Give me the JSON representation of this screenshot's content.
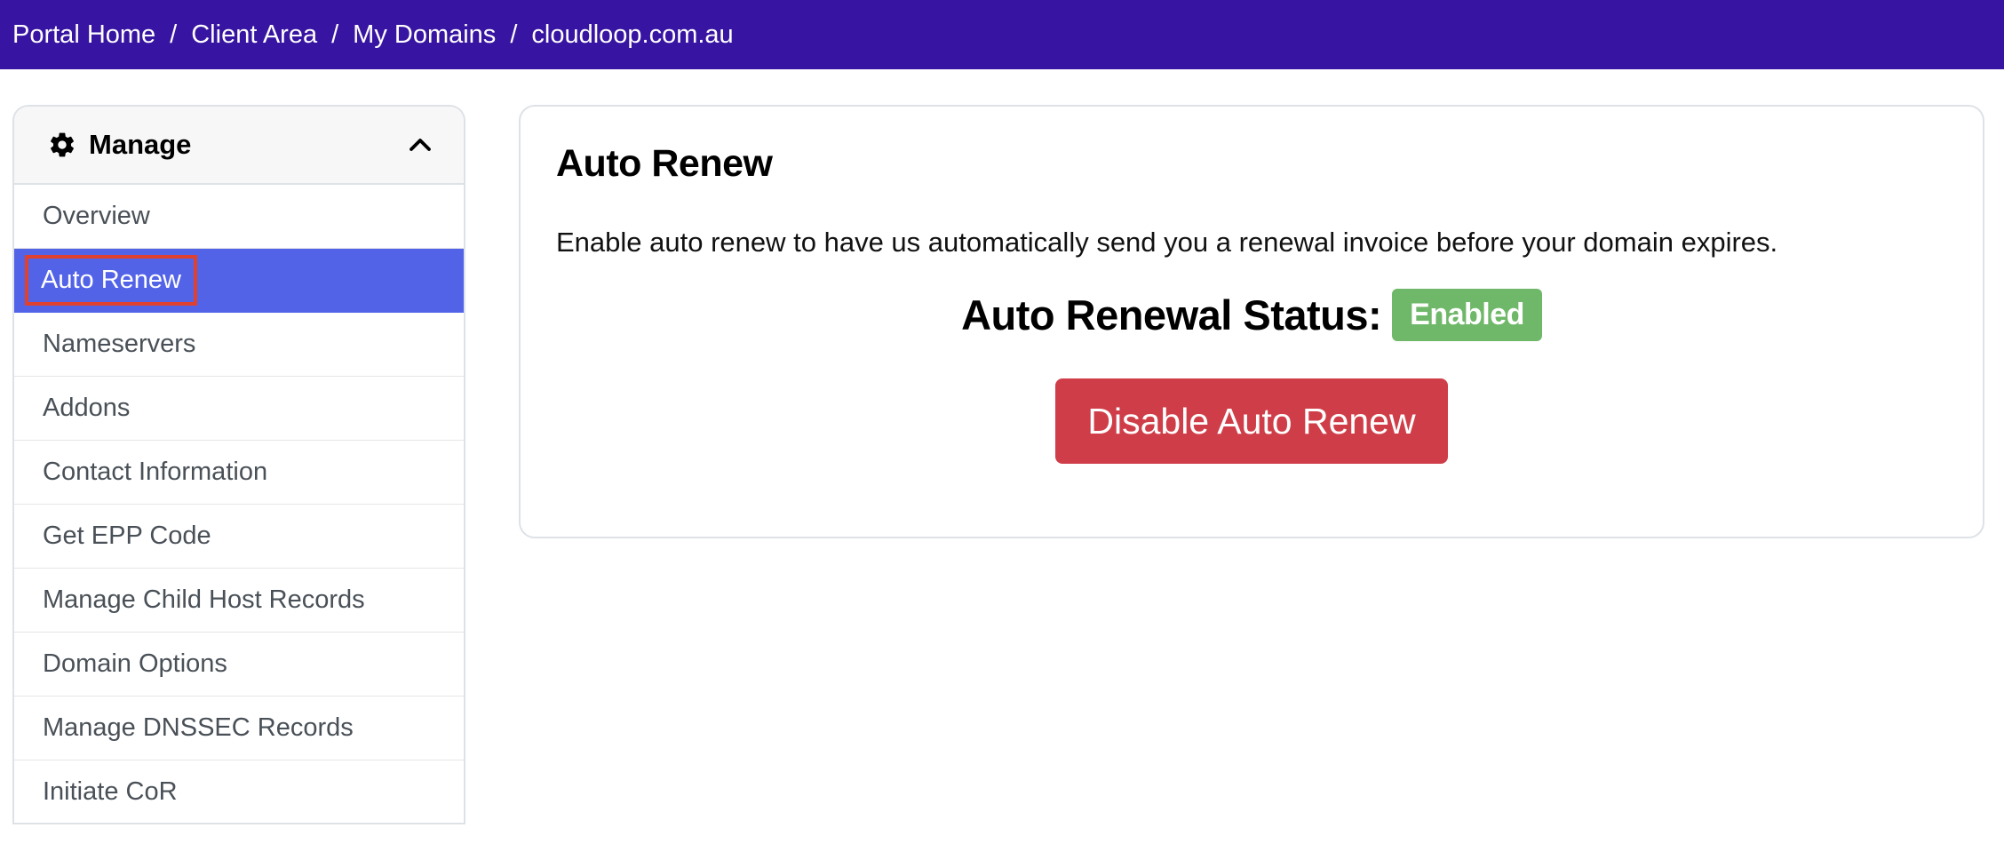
{
  "breadcrumb": {
    "items": [
      "Portal Home",
      "Client Area",
      "My Domains",
      "cloudloop.com.au"
    ],
    "separator": "/"
  },
  "sidebar": {
    "header": {
      "title": "Manage",
      "icon": "gear-icon",
      "toggle_icon": "chevron-up-icon"
    },
    "items": [
      {
        "label": "Overview",
        "active": false
      },
      {
        "label": "Auto Renew",
        "active": true
      },
      {
        "label": "Nameservers",
        "active": false
      },
      {
        "label": "Addons",
        "active": false
      },
      {
        "label": "Contact Information",
        "active": false
      },
      {
        "label": "Get EPP Code",
        "active": false
      },
      {
        "label": "Manage Child Host Records",
        "active": false
      },
      {
        "label": "Domain Options",
        "active": false
      },
      {
        "label": "Manage DNSSEC Records",
        "active": false
      },
      {
        "label": "Initiate CoR",
        "active": false
      }
    ]
  },
  "main": {
    "title": "Auto Renew",
    "description": "Enable auto renew to have us automatically send you a renewal invoice before your domain expires.",
    "status_label": "Auto Renewal Status:",
    "status_value": "Enabled",
    "action_button": "Disable Auto Renew"
  },
  "colors": {
    "topbar": "#3714a1",
    "active_item": "#5263e8",
    "highlight_outline": "#e0412f",
    "status_badge": "#6fb869",
    "danger_button": "#cf3e48"
  }
}
